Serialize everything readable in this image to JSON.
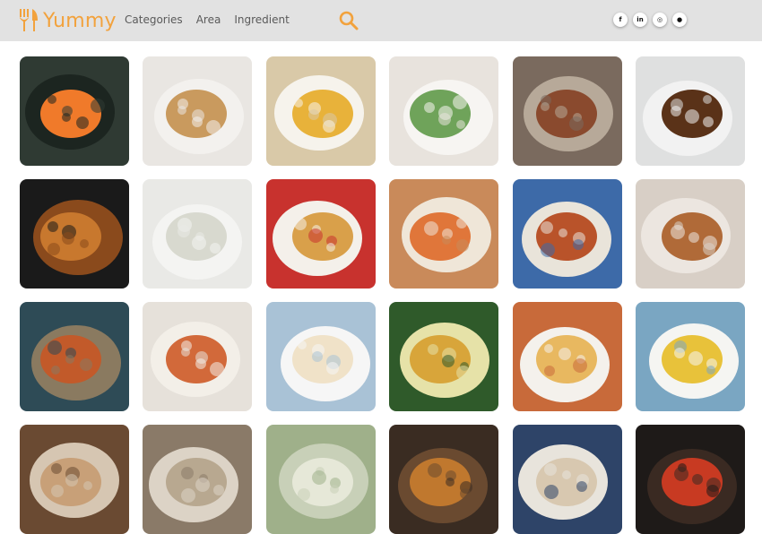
{
  "header": {
    "brand": "Yummy",
    "brand_color": "#f2a23d",
    "background": "#e2e2e2",
    "nav": [
      {
        "label": "Categories"
      },
      {
        "label": "Area"
      },
      {
        "label": "Ingredient"
      }
    ],
    "search_icon": "search-icon",
    "socials": [
      {
        "name": "facebook-icon",
        "glyph": "f"
      },
      {
        "name": "linkedin-icon",
        "glyph": "in"
      },
      {
        "name": "instagram-icon",
        "glyph": "◎"
      },
      {
        "name": "github-icon",
        "glyph": "●"
      }
    ]
  },
  "meals": [
    {
      "name": "meal-sushi",
      "bg": "#2f3a33",
      "accent": "#f07a2a",
      "plate": "#1c2520"
    },
    {
      "name": "meal-meat-pie",
      "bg": "#e9e6e2",
      "accent": "#c99a5e",
      "plate": "#f3f1ee"
    },
    {
      "name": "meal-lentil-soup",
      "bg": "#d9c9a8",
      "accent": "#e8b23a",
      "plate": "#f6f3ec"
    },
    {
      "name": "meal-stuffed-potato",
      "bg": "#e8e3dd",
      "accent": "#6fa35a",
      "plate": "#f7f5f2"
    },
    {
      "name": "meal-liver-onions",
      "bg": "#7a6a5e",
      "accent": "#8a4a2e",
      "plate": "#b7a999"
    },
    {
      "name": "meal-falafel",
      "bg": "#dfe0e0",
      "accent": "#5a3218",
      "plate": "#f2f2f2"
    },
    {
      "name": "meal-burger",
      "bg": "#1a1a1a",
      "accent": "#c8782e",
      "plate": "#8a4a1c"
    },
    {
      "name": "meal-dumplings",
      "bg": "#e9e9e6",
      "accent": "#d8d9cf",
      "plate": "#f4f4f2"
    },
    {
      "name": "meal-lasagna",
      "bg": "#c8322e",
      "accent": "#d9a04a",
      "plate": "#f4f0ea"
    },
    {
      "name": "meal-poutine",
      "bg": "#c98a5a",
      "accent": "#e0763a",
      "plate": "#efe6d8"
    },
    {
      "name": "meal-tagine",
      "bg": "#3d6aa8",
      "accent": "#b9532a",
      "plate": "#e9e4da"
    },
    {
      "name": "meal-beignets",
      "bg": "#d8cfc6",
      "accent": "#b06a38",
      "plate": "#ece6e0"
    },
    {
      "name": "meal-harira",
      "bg": "#2e4b56",
      "accent": "#c25a2a",
      "plate": "#8a7a60"
    },
    {
      "name": "meal-koshari",
      "bg": "#e6e1da",
      "accent": "#d2693a",
      "plate": "#f3efe8"
    },
    {
      "name": "meal-fish-pie",
      "bg": "#a9c2d6",
      "accent": "#f0e2c8",
      "plate": "#f6f6f6"
    },
    {
      "name": "meal-salad-plate",
      "bg": "#2f5a2a",
      "accent": "#d8a53a",
      "plate": "#e6e2a8"
    },
    {
      "name": "meal-pancakes",
      "bg": "#c86a3a",
      "accent": "#e8b860",
      "plate": "#f4f1ec"
    },
    {
      "name": "meal-kedgeree",
      "bg": "#7aa6c2",
      "accent": "#e8c23a",
      "plate": "#f5f5f2"
    },
    {
      "name": "meal-row4-1",
      "bg": "#6a4a32",
      "accent": "#c8a078",
      "plate": "#d6c6b2"
    },
    {
      "name": "meal-row4-2",
      "bg": "#8a7a68",
      "accent": "#b8a890",
      "plate": "#dcd3c6"
    },
    {
      "name": "meal-row4-3",
      "bg": "#9fb08a",
      "accent": "#e6e8d8",
      "plate": "#c8d0b8"
    },
    {
      "name": "meal-row4-4",
      "bg": "#3a2c22",
      "accent": "#c0782e",
      "plate": "#6a4a30"
    },
    {
      "name": "meal-row4-5",
      "bg": "#2e4468",
      "accent": "#d8c8b0",
      "plate": "#e8e4dc"
    },
    {
      "name": "meal-row4-6",
      "bg": "#1e1a18",
      "accent": "#c83a22",
      "plate": "#3a2a22"
    }
  ]
}
